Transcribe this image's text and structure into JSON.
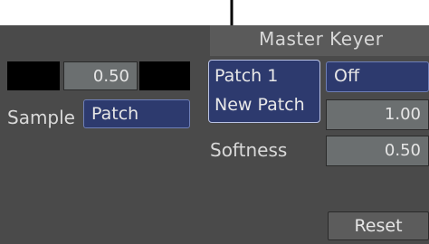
{
  "header": {
    "title": "Master Keyer"
  },
  "left": {
    "value_field": "0.50",
    "sample_label": "Sample",
    "sample_dropdown": "Patch"
  },
  "keyer": {
    "patch_menu_items": [
      "Patch 1",
      "New Patch"
    ],
    "mode_dropdown": "Off",
    "value_field_1": "1.00",
    "softness_label": "Softness",
    "softness_value": "0.50",
    "reset_label": "Reset"
  },
  "colors": {
    "panel": "#4a4a4a",
    "field_grey": "#6b6f70",
    "field_blue": "#2d3a6e",
    "menu_border": "#b9c2e4"
  }
}
